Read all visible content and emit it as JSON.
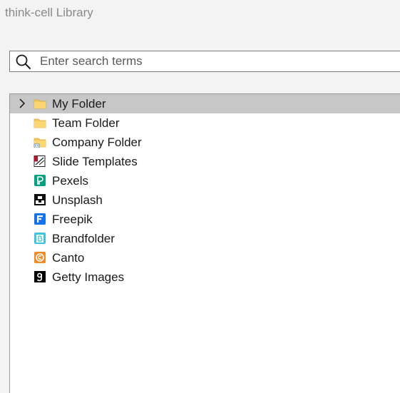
{
  "app": {
    "title": "think-cell Library"
  },
  "search": {
    "placeholder": "Enter search terms",
    "value": ""
  },
  "tree": {
    "items": [
      {
        "label": "My Folder",
        "icon": "folder-icon",
        "expandable": true,
        "selected": true
      },
      {
        "label": "Team Folder",
        "icon": "folder-icon",
        "expandable": false,
        "selected": false
      },
      {
        "label": "Company Folder",
        "icon": "shared-folder-icon",
        "expandable": false,
        "selected": false
      },
      {
        "label": "Slide Templates",
        "icon": "slide-templates-icon",
        "expandable": false,
        "selected": false
      },
      {
        "label": "Pexels",
        "icon": "pexels-icon",
        "expandable": false,
        "selected": false
      },
      {
        "label": "Unsplash",
        "icon": "unsplash-icon",
        "expandable": false,
        "selected": false
      },
      {
        "label": "Freepik",
        "icon": "freepik-icon",
        "expandable": false,
        "selected": false
      },
      {
        "label": "Brandfolder",
        "icon": "brandfolder-icon",
        "expandable": false,
        "selected": false
      },
      {
        "label": "Canto",
        "icon": "canto-icon",
        "expandable": false,
        "selected": false
      },
      {
        "label": "Getty Images",
        "icon": "getty-images-icon",
        "expandable": false,
        "selected": false
      }
    ]
  },
  "colors": {
    "background": "#f3f3f3",
    "selected_row": "#c7c7c7",
    "folder": "#f5c85c",
    "pexels": "#07a081",
    "freepik": "#1273eb",
    "brandfolder": "#40c4e0",
    "canto": "#f08c28"
  }
}
